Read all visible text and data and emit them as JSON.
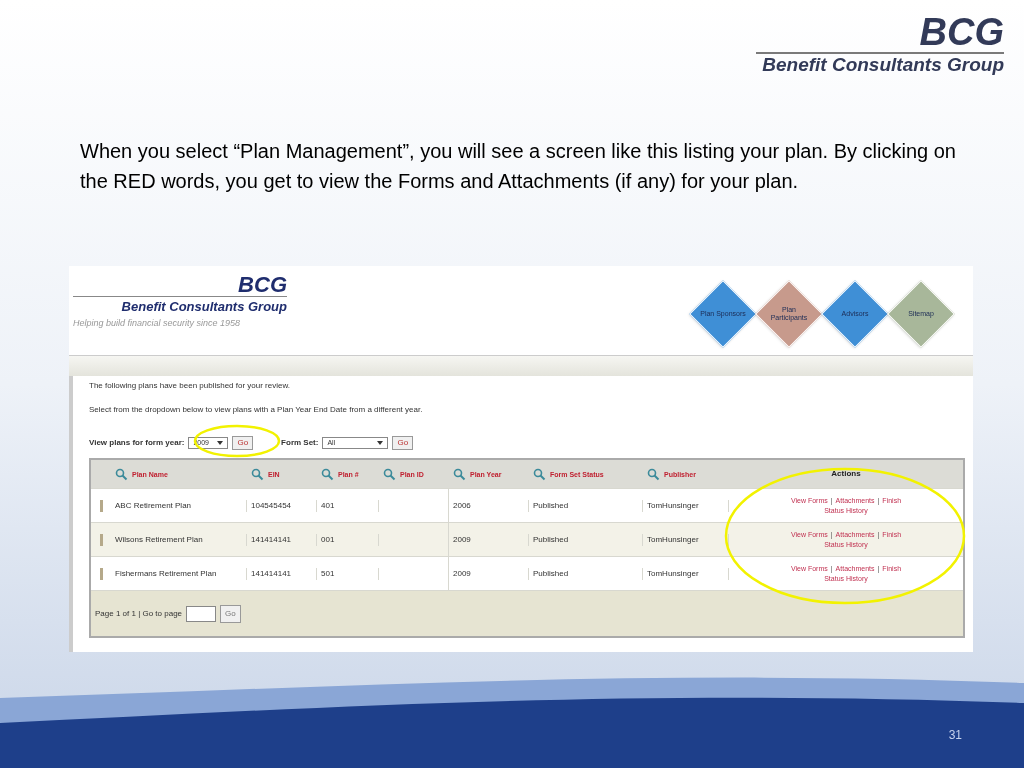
{
  "logo": {
    "mark": "BCG",
    "name": "Benefit Consultants Group"
  },
  "paragraph": "When you select “Plan Management”, you will see a screen like this listing your plan.  By clicking on the RED words, you get to view the Forms and Attachments (if any) for your plan.",
  "screenshot": {
    "logo": {
      "mark": "BCG",
      "name": "Benefit Consultants Group",
      "tagline": "Helping build financial security since 1958"
    },
    "nav": [
      {
        "label": "Plan Sponsors",
        "color": "#3f8fd6"
      },
      {
        "label": "Plan Participants",
        "color": "#c79a8c"
      },
      {
        "label": "Advisors",
        "color": "#3f8fd6"
      },
      {
        "label": "Sitemap",
        "color": "#a8b79a"
      }
    ],
    "intro": [
      "The following plans have been published for your review.",
      "Select from the dropdown below to view plans with a Plan Year End Date from a different year."
    ],
    "year_filter": {
      "label": "View plans for form year:",
      "value": "2009",
      "button": "Go",
      "highlighted": true
    },
    "formset_filter": {
      "label": "Form Set:",
      "value": "All",
      "button": "Go"
    },
    "columns": [
      "Plan Name",
      "EIN",
      "Plan #",
      "Plan ID",
      "Plan Year",
      "Form Set Status",
      "Publisher",
      "Actions"
    ],
    "rows": [
      {
        "plan_name": "ABC Retirement Plan",
        "ein": "104545454",
        "plan_no": "401",
        "plan_year": "2006",
        "status": "Published",
        "publisher": "TomHunsinger",
        "actions": [
          "View Forms",
          "Attachments",
          "Finish",
          "Status History"
        ]
      },
      {
        "plan_name": "Wilsons Retirement Plan",
        "ein": "141414141",
        "plan_no": "001",
        "plan_year": "2009",
        "status": "Published",
        "publisher": "TomHunsinger",
        "actions": [
          "View Forms",
          "Attachments",
          "Finish",
          "Status History"
        ]
      },
      {
        "plan_name": "Fishermans Retirement Plan",
        "ein": "141414141",
        "plan_no": "501",
        "plan_year": "2009",
        "status": "Published",
        "publisher": "TomHunsinger",
        "actions": [
          "View Forms",
          "Attachments",
          "Finish",
          "Status History"
        ]
      }
    ],
    "action_separator": "|",
    "actions_highlighted": true,
    "pager": {
      "text": "Page 1 of 1 | Go to page",
      "button": "Go"
    }
  },
  "page_number": "31"
}
